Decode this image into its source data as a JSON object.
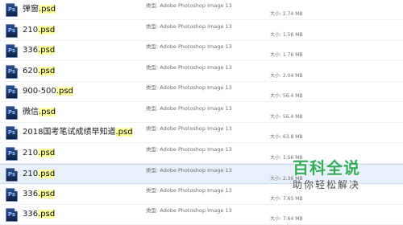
{
  "icon": {
    "name": "photoshop-file-icon",
    "label": "Ps"
  },
  "files": [
    {
      "name": "弹窗",
      "ext": ".psd",
      "type": "类型: Adobe Photoshop Image 13",
      "size": "大小: 2.74 MB"
    },
    {
      "name": "210",
      "ext": ".psd",
      "type": "类型: Adobe Photoshop Image 13",
      "size": "大小: 1.56 MB"
    },
    {
      "name": "336",
      "ext": ".psd",
      "type": "类型: Adobe Photoshop Image 13",
      "size": "大小: 1.76 MB"
    },
    {
      "name": "620",
      "ext": ".psd",
      "type": "类型: Adobe Photoshop Image 13",
      "size": "大小: 2.04 MB"
    },
    {
      "name": "900-500",
      "ext": ".psd",
      "type": "类型: Adobe Photoshop Image 13",
      "size": "大小: 56.4 MB"
    },
    {
      "name": "微信",
      "ext": ".psd",
      "type": "类型: Adobe Photoshop Image 13",
      "size": "大小: 56.4 MB"
    },
    {
      "name": "2018国考笔试成绩早知道",
      "ext": ".psd",
      "type": "类型: Adobe Photoshop Image 13",
      "size": "大小: 63.8 MB"
    },
    {
      "name": "210",
      "ext": ".psd",
      "type": "类型: Adobe Photoshop Image 13",
      "size": "大小: 1.56 MB"
    },
    {
      "name": "210",
      "ext": ".psd",
      "type": "类型: Adobe Photoshop Image 13",
      "size": "大小: 2.36 MB"
    },
    {
      "name": "336",
      "ext": ".psd",
      "type": "类型: Adobe Photoshop Image 13",
      "size": "大小: 7.65 MB"
    },
    {
      "name": "336",
      "ext": ".psd",
      "type": "类型: Adobe Photoshop Image 13",
      "size": "大小: 7.64 MB"
    }
  ],
  "watermark": {
    "title": "百科全说",
    "subtitle": "助你轻松解决"
  }
}
